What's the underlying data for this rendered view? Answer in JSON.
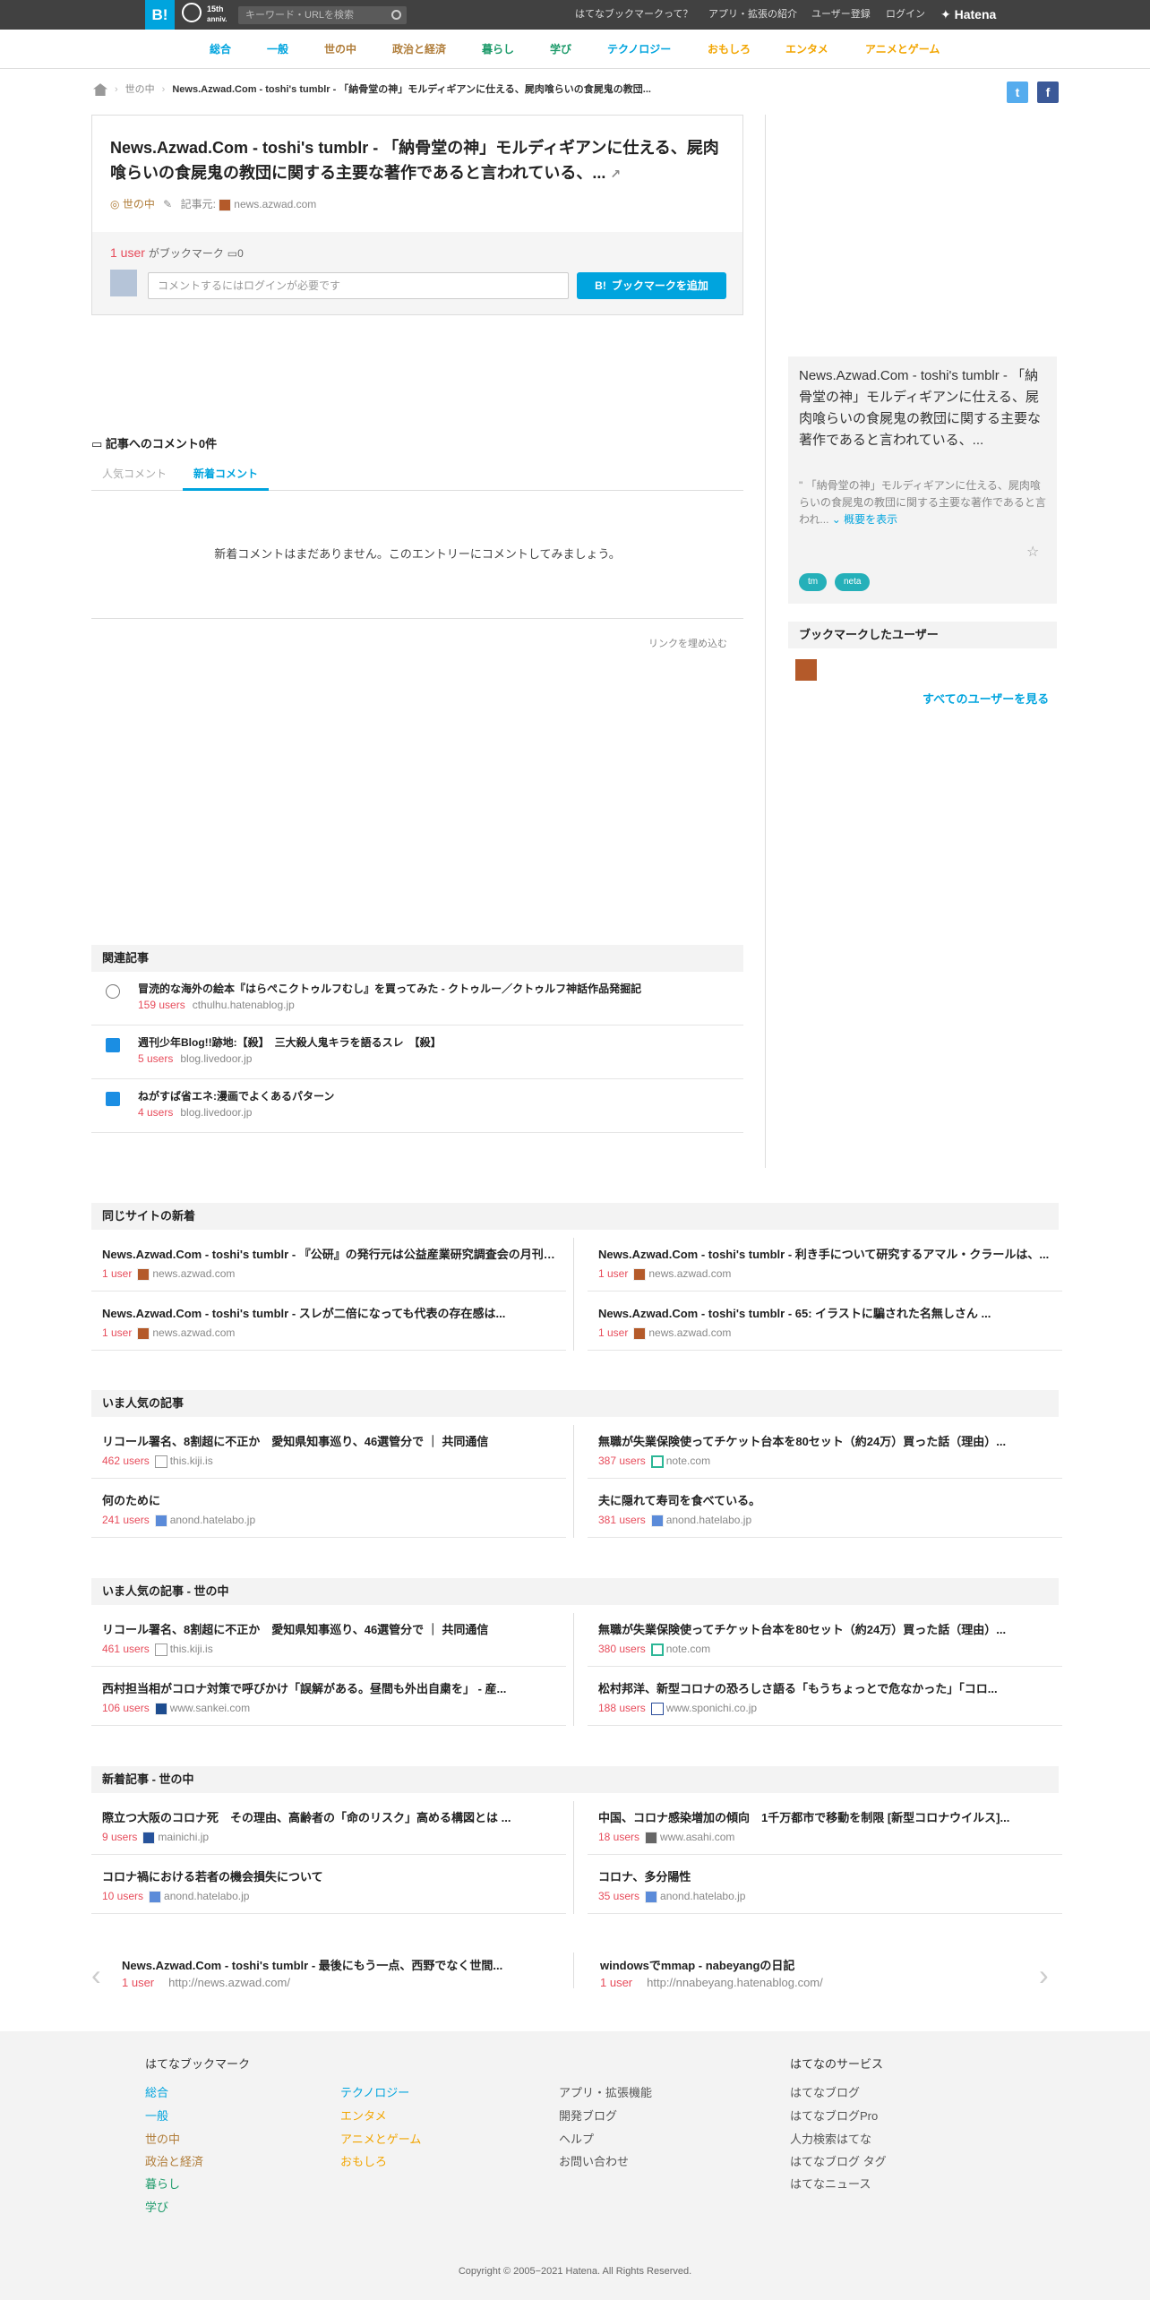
{
  "header": {
    "logo": "B!",
    "anniversary_top": "15th",
    "anniversary_bottom": "anniv.",
    "search_placeholder": "キーワード・URLを検索",
    "links": [
      "はてなブックマークって？",
      "アプリ・拡張の紹介",
      "ユーザー登録",
      "ログイン"
    ],
    "brand": "Hatena"
  },
  "categories": [
    {
      "label": "総合",
      "color": "#00a4de"
    },
    {
      "label": "一般",
      "color": "#00a4de"
    },
    {
      "label": "世の中",
      "color": "#b07d3a"
    },
    {
      "label": "政治と経済",
      "color": "#b07d3a"
    },
    {
      "label": "暮らし",
      "color": "#1e9b6b"
    },
    {
      "label": "学び",
      "color": "#1e9b6b"
    },
    {
      "label": "テクノロジー",
      "color": "#00a4de"
    },
    {
      "label": "おもしろ",
      "color": "#f2a500"
    },
    {
      "label": "エンタメ",
      "color": "#f2a500"
    },
    {
      "label": "アニメとゲーム",
      "color": "#f2a500"
    }
  ],
  "breadcrumb": {
    "category": "世の中",
    "current": "News.Azwad.Com - toshi's tumblr - 「納骨堂の神」モルディギアンに仕える、屍肉喰らいの食屍鬼の教団..."
  },
  "entry": {
    "title": "News.Azwad.Com - toshi's tumblr - 「納骨堂の神」モルディギアンに仕える、屍肉喰らいの食屍鬼の教団に関する主要な著作であると言われている、...",
    "category": "世の中",
    "source_label": "記事元:",
    "source": "news.azwad.com",
    "users": "1 user",
    "bookmarked_suffix": "がブックマーク",
    "comment_count": "0",
    "comment_placeholder": "コメントするにはログインが必要です",
    "add_button": "ブックマークを追加"
  },
  "comments": {
    "heading": "記事へのコメント0件",
    "tab_popular": "人気コメント",
    "tab_new": "新着コメント",
    "empty": "新着コメントはまだありません。このエントリーにコメントしてみましょう。",
    "embed": "リンクを埋め込む"
  },
  "sidebar": {
    "title": "News.Azwad.Com - toshi's tumblr - 「納骨堂の神」モルディギアンに仕える、屍肉喰らいの食屍鬼の教団に関する主要な著作であると言われている、...",
    "desc": "\" 「納骨堂の神」モルディギアンに仕える、屍肉喰らいの食屍鬼の教団に関する主要な著作であると言われ...",
    "show_summary": "概要を表示",
    "tags": [
      "tm",
      "neta"
    ],
    "bookmark_users_heading": "ブックマークしたユーザー",
    "all_users": "すべてのユーザーを見る"
  },
  "related": {
    "heading": "関連記事",
    "items": [
      {
        "title": "冒涜的な海外の絵本『はらぺこクトゥルフむし』を買ってみた - クトゥルー／クトゥルフ神話作品発掘記",
        "users": "159 users",
        "domain": "cthulhu.hatenablog.jp"
      },
      {
        "title": "週刊少年Blog!!跡地:【殺】　三大殺人鬼キラを語るスレ　【殺】",
        "users": "5 users",
        "domain": "blog.livedoor.jp"
      },
      {
        "title": "ねがすば省エネ:漫画でよくあるパターン",
        "users": "4 users",
        "domain": "blog.livedoor.jp"
      }
    ]
  },
  "same_site": {
    "heading": "同じサイトの新着",
    "items": [
      {
        "title": "News.Azwad.Com - toshi's tumblr - 『公研』の発行元は公益産業研究調査会の月刊誌で、...",
        "users": "1 user",
        "domain": "news.azwad.com"
      },
      {
        "title": "News.Azwad.Com - toshi's tumblr - 利き手について研究するアマル・クラールは、...",
        "users": "1 user",
        "domain": "news.azwad.com"
      },
      {
        "title": "News.Azwad.Com - toshi's tumblr - スレが二倍になっても代表の存在感は...",
        "users": "1 user",
        "domain": "news.azwad.com"
      },
      {
        "title": "News.Azwad.Com - toshi's tumblr - 65: イラストに騙された名無しさん ...",
        "users": "1 user",
        "domain": "news.azwad.com"
      }
    ]
  },
  "popular": {
    "heading": "いま人気の記事",
    "items": [
      {
        "title": "リコール署名、8割超に不正か　愛知県知事巡り、46選管分で ｜ 共同通信",
        "users": "462 users",
        "domain": "this.kiji.is"
      },
      {
        "title": "無職が失業保険使ってチケット台本を80セット（約24万）買った話（理由）...",
        "users": "387 users",
        "domain": "note.com"
      },
      {
        "title": "何のために",
        "users": "241 users",
        "domain": "anond.hatelabo.jp"
      },
      {
        "title": "夫に隠れて寿司を食べている。",
        "users": "381 users",
        "domain": "anond.hatelabo.jp"
      }
    ]
  },
  "popular_society": {
    "heading": "いま人気の記事 - 世の中",
    "items": [
      {
        "title": "リコール署名、8割超に不正か　愛知県知事巡り、46選管分で ｜ 共同通信",
        "users": "461 users",
        "domain": "this.kiji.is"
      },
      {
        "title": "無職が失業保険使ってチケット台本を80セット（約24万）買った話（理由）...",
        "users": "380 users",
        "domain": "note.com"
      },
      {
        "title": "西村担当相がコロナ対策で呼びかけ「誤解がある。昼間も外出自粛を」 - 産...",
        "users": "106 users",
        "domain": "www.sankei.com"
      },
      {
        "title": "松村邦洋、新型コロナの恐ろしさ語る「もうちょっとで危なかった」「コロ...",
        "users": "188 users",
        "domain": "www.sponichi.co.jp"
      }
    ]
  },
  "new_society": {
    "heading": "新着記事 - 世の中",
    "items": [
      {
        "title": "際立つ大阪のコロナ死　その理由、高齢者の「命のリスク」高める構図とは ...",
        "users": "9 users",
        "domain": "mainichi.jp"
      },
      {
        "title": "中国、コロナ感染増加の傾向　1千万都市で移動を制限 [新型コロナウイルス]...",
        "users": "18 users",
        "domain": "www.asahi.com"
      },
      {
        "title": "コロナ禍における若者の機会損失について",
        "users": "10 users",
        "domain": "anond.hatelabo.jp"
      },
      {
        "title": "コロナ、多分陽性",
        "users": "35 users",
        "domain": "anond.hatelabo.jp"
      }
    ]
  },
  "pager": {
    "prev_title": "News.Azwad.Com - toshi's tumblr - 最後にもう一点、西野でなく世間...",
    "prev_users": "1 user",
    "prev_url": "http://news.azwad.com/",
    "next_title": "windowsでmmap - nabeyangの日記",
    "next_users": "1 user",
    "next_url": "http://nnabeyang.hatenablog.com/"
  },
  "footer": {
    "head_bookmark": "はてなブックマーク",
    "head_services": "はてなのサービス",
    "col1": [
      "総合",
      "一般",
      "世の中",
      "政治と経済",
      "暮らし",
      "学び"
    ],
    "col2": [
      "テクノロジー",
      "エンタメ",
      "アニメとゲーム",
      "おもしろ"
    ],
    "col3": [
      "アプリ・拡張機能",
      "開発ブログ",
      "ヘルプ",
      "お問い合わせ"
    ],
    "col4": [
      "はてなブログ",
      "はてなブログPro",
      "人力検索はてな",
      "はてなブログ タグ",
      "はてなニュース"
    ],
    "copyright": "Copyright © 2005−2021 Hatena. All Rights Reserved."
  }
}
